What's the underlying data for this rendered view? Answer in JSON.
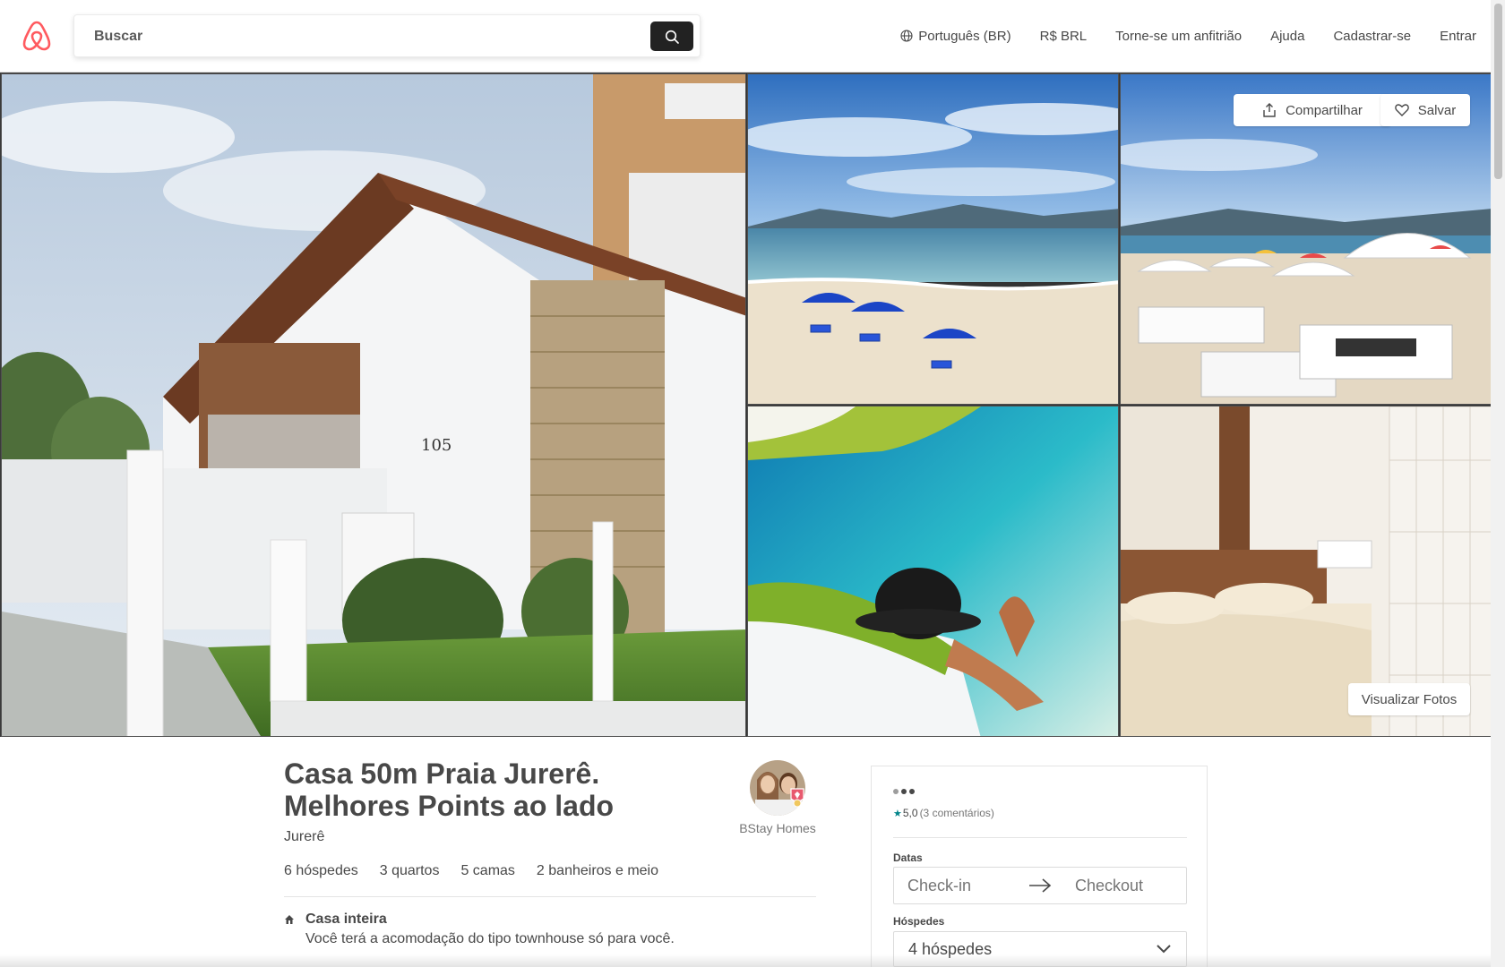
{
  "header": {
    "search_placeholder": "Buscar",
    "nav": {
      "language": "Português (BR)",
      "currency": "R$ BRL",
      "host": "Torne-se um anfitrião",
      "help": "Ajuda",
      "signup": "Cadastrar-se",
      "login": "Entrar"
    }
  },
  "photos": {
    "share_label": "Compartilhar",
    "save_label": "Salvar",
    "view_label": "Visualizar Fotos"
  },
  "listing": {
    "title": "Casa 50m Praia Jurerê. Melhores Points ao lado",
    "location": "Jurerê",
    "host_name": "BStay Homes",
    "summary": {
      "guests": "6 hóspedes",
      "bedrooms": "3 quartos",
      "beds": "5 camas",
      "baths": "2 banheiros e meio"
    },
    "feature": {
      "title": "Casa inteira",
      "description": "Você terá a acomodação do tipo townhouse só para você."
    }
  },
  "booking": {
    "rating": "5,0",
    "reviews": "(3 comentários)",
    "dates_label": "Datas",
    "checkin_placeholder": "Check-in",
    "checkout_placeholder": "Checkout",
    "guests_label": "Hóspedes",
    "guests_value": "4 hóspedes"
  },
  "colors": {
    "brand": "#FF5A5F",
    "accent": "#008489",
    "text": "#484848"
  }
}
